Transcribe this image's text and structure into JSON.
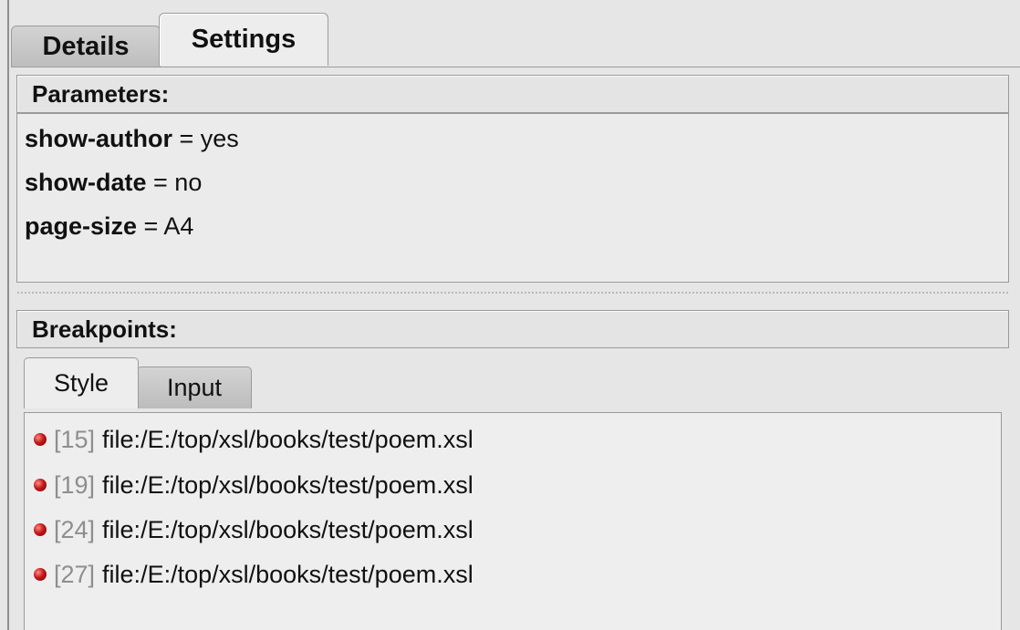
{
  "tabs": {
    "details_label": "Details",
    "settings_label": "Settings",
    "active": "Settings"
  },
  "parameters": {
    "header": "Parameters:",
    "items": [
      {
        "name": "show-author",
        "sep": " = ",
        "value": "yes"
      },
      {
        "name": "show-date",
        "sep": " = ",
        "value": "no"
      },
      {
        "name": "page-size",
        "sep": " = ",
        "value": "A4"
      }
    ]
  },
  "breakpoints": {
    "header": "Breakpoints:",
    "tabs": {
      "style_label": "Style",
      "input_label": "Input",
      "active": "Style"
    },
    "items": [
      {
        "line": "[15]",
        "file": "file:/E:/top/xsl/books/test/poem.xsl"
      },
      {
        "line": "[19]",
        "file": "file:/E:/top/xsl/books/test/poem.xsl"
      },
      {
        "line": "[24]",
        "file": "file:/E:/top/xsl/books/test/poem.xsl"
      },
      {
        "line": "[27]",
        "file": "file:/E:/top/xsl/books/test/poem.xsl"
      }
    ],
    "marker_icon": "breakpoint-dot-icon",
    "marker_color": "#c41a1a"
  }
}
